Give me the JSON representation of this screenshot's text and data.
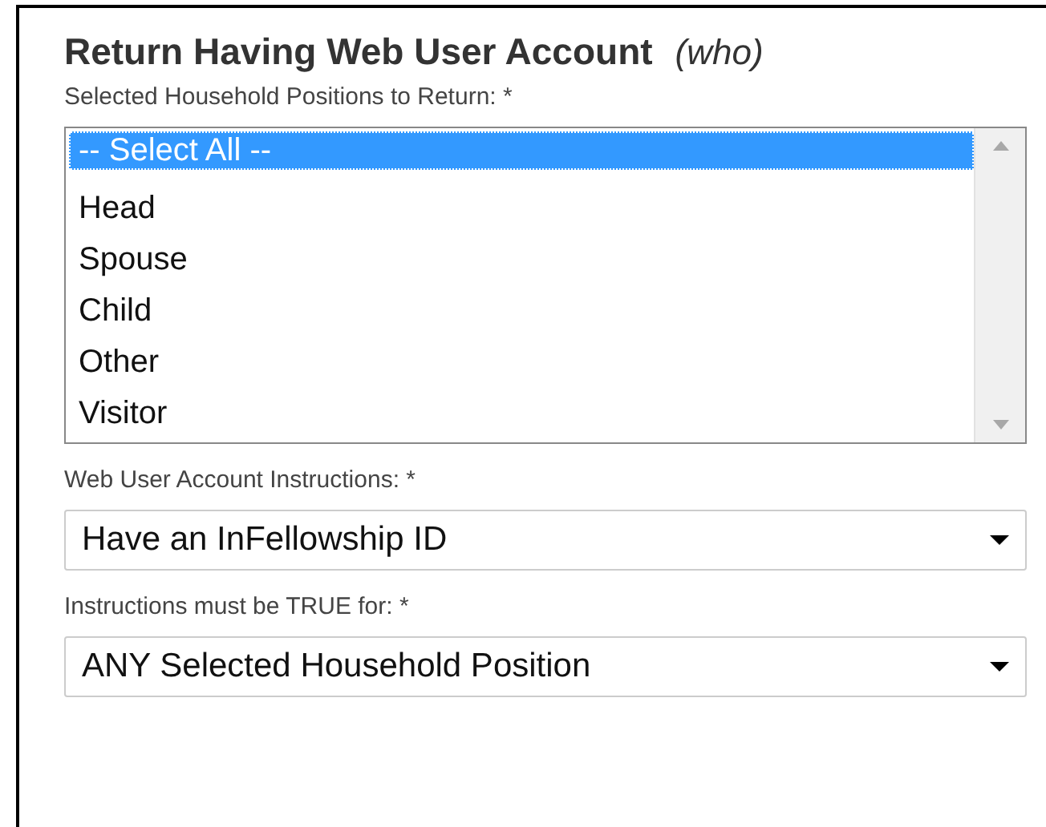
{
  "title": "Return Having Web User Account",
  "subtitle": "(who)",
  "positions": {
    "label": "Selected Household Positions to Return: *",
    "options": [
      {
        "label": "-- Select All --",
        "selected": true
      },
      {
        "label": "Head",
        "selected": false
      },
      {
        "label": "Spouse",
        "selected": false
      },
      {
        "label": "Child",
        "selected": false
      },
      {
        "label": "Other",
        "selected": false
      },
      {
        "label": "Visitor",
        "selected": false
      }
    ]
  },
  "instructions": {
    "label": "Web User Account Instructions: *",
    "value": "Have an InFellowship ID"
  },
  "true_for": {
    "label": "Instructions must be TRUE for: *",
    "value": "ANY Selected Household Position"
  }
}
